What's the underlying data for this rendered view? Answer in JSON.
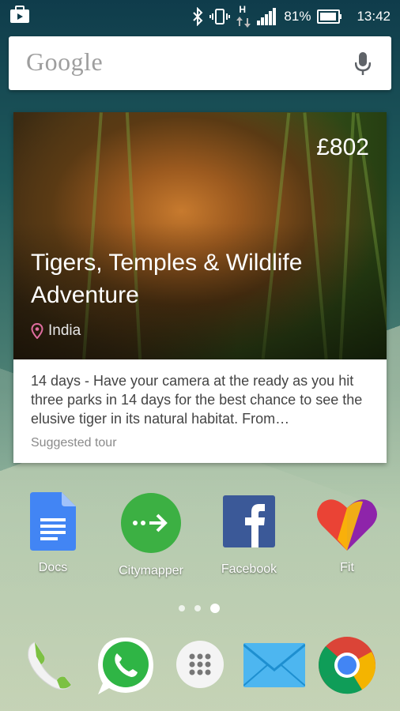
{
  "status_bar": {
    "battery_percent": "81%",
    "time": "13:42",
    "network_type": "H",
    "icons": [
      "briefcase-icon",
      "bluetooth-icon",
      "vibrate-icon",
      "data-arrows-icon",
      "signal-icon",
      "battery-icon"
    ]
  },
  "search": {
    "logo_text": "Google",
    "mic_icon": "mic-icon"
  },
  "card": {
    "price": "£802",
    "title": "Tigers, Temples & Wildlife Adventure",
    "location": "India",
    "description": "14 days - Have your camera at the ready as you hit three parks in 14 days for the best chance to see the elusive tiger in its natural habitat. From…",
    "tag": "Suggested tour"
  },
  "apps": [
    {
      "label": "Docs",
      "icon": "docs-icon"
    },
    {
      "label": "Citymapper",
      "icon": "citymapper-icon"
    },
    {
      "label": "Facebook",
      "icon": "facebook-icon"
    },
    {
      "label": "Fit",
      "icon": "fit-heart-icon"
    }
  ],
  "pager": {
    "count": 3,
    "active_index": 2
  },
  "dock": [
    {
      "icon": "phone-icon"
    },
    {
      "icon": "whatsapp-icon"
    },
    {
      "icon": "app-drawer-icon"
    },
    {
      "icon": "email-icon"
    },
    {
      "icon": "chrome-icon"
    }
  ],
  "colors": {
    "docs_blue": "#4285f4",
    "citymapper_green": "#3cb043",
    "facebook_blue": "#3b5998",
    "location_pin": "#e06da0"
  }
}
